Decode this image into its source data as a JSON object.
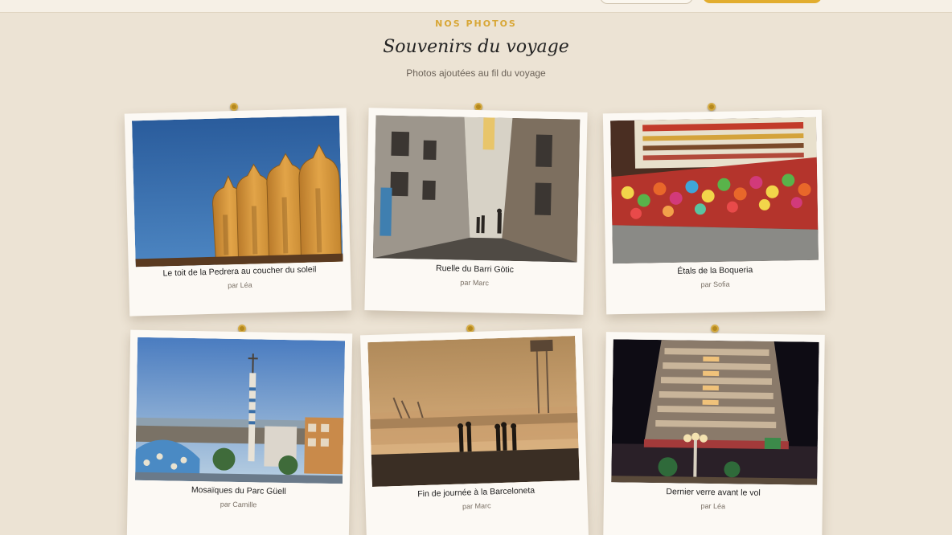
{
  "header": {
    "eyebrow": "NOS PHOTOS",
    "title": "Souvenirs du voyage",
    "subtitle": "Photos ajoutées au fil du voyage"
  },
  "photos": [
    {
      "caption": "Le toit de la Pedrera au coucher du soleil",
      "author": "par Léa",
      "icon": "pedrera-chimneys-photo"
    },
    {
      "caption": "Ruelle du Barri Gòtic",
      "author": "par Marc",
      "icon": "gothic-alley-photo"
    },
    {
      "caption": "Étals de la Boqueria",
      "author": "par Sofia",
      "icon": "boqueria-candy-stall-photo"
    },
    {
      "caption": "Mosaïques du Parc Güell",
      "author": "par Camille",
      "icon": "park-guell-mosaic-photo"
    },
    {
      "caption": "Fin de journée à la Barceloneta",
      "author": "par Marc",
      "icon": "barceloneta-sunset-photo"
    },
    {
      "caption": "Dernier verre avant le vol",
      "author": "par Léa",
      "icon": "night-building-photo"
    }
  ],
  "colors": {
    "background": "#ece3d4",
    "accent": "#d8a737",
    "card": "#fcf9f4",
    "pin": "#b68a1f"
  }
}
